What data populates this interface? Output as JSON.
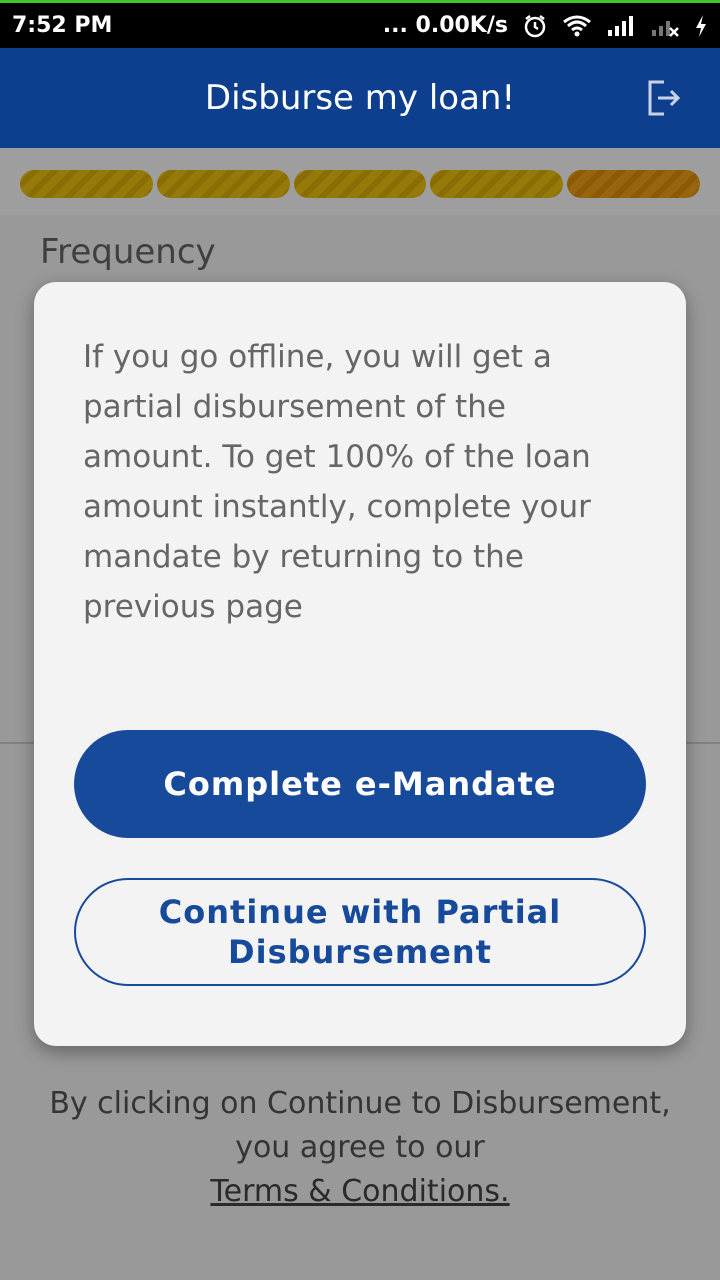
{
  "status_bar": {
    "time": "7:52 PM",
    "net_speed": "... 0.00K/s",
    "icons": [
      "alarm-icon",
      "wifi-icon",
      "signal-icon",
      "signal-x-icon",
      "charging-icon"
    ]
  },
  "header": {
    "title": "Disburse my loan!",
    "logout_icon": "logout-icon"
  },
  "progress": {
    "segments": 5,
    "completed": 5
  },
  "page": {
    "frequency_label": "Frequency",
    "consent_text": "By clicking on Continue to Disbursement, you agree to our",
    "terms_link": "Terms & Conditions."
  },
  "modal": {
    "message": "If you go offline, you will get a partial disbursement of the amount. To get 100% of the loan amount instantly, complete your mandate by returning to the previous page",
    "primary_button": "Complete e-Mandate",
    "secondary_button": "Continue with Partial Disbursement"
  },
  "colors": {
    "header_bg": "#0e3f8f",
    "primary": "#174a9b",
    "progress_yellow": "#f1c40f",
    "progress_orange": "#f4a316"
  }
}
